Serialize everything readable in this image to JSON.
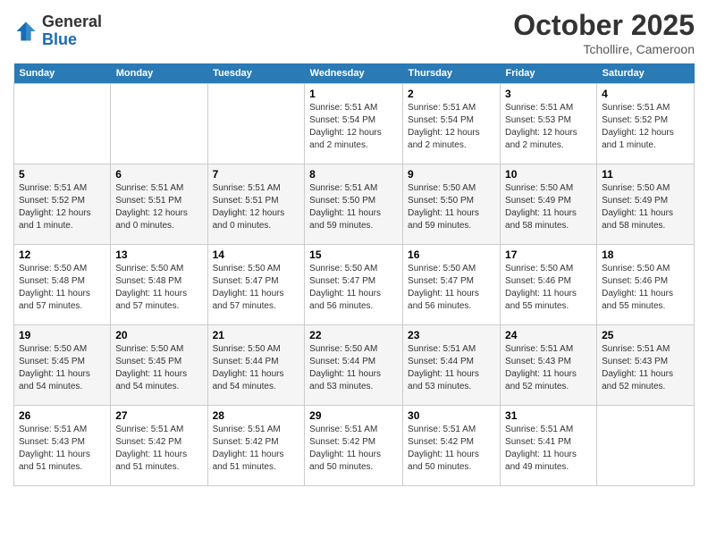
{
  "header": {
    "logo_general": "General",
    "logo_blue": "Blue",
    "month": "October 2025",
    "location": "Tchollire, Cameroon"
  },
  "days_of_week": [
    "Sunday",
    "Monday",
    "Tuesday",
    "Wednesday",
    "Thursday",
    "Friday",
    "Saturday"
  ],
  "weeks": [
    [
      {
        "day": "",
        "info": ""
      },
      {
        "day": "",
        "info": ""
      },
      {
        "day": "",
        "info": ""
      },
      {
        "day": "1",
        "info": "Sunrise: 5:51 AM\nSunset: 5:54 PM\nDaylight: 12 hours\nand 2 minutes."
      },
      {
        "day": "2",
        "info": "Sunrise: 5:51 AM\nSunset: 5:54 PM\nDaylight: 12 hours\nand 2 minutes."
      },
      {
        "day": "3",
        "info": "Sunrise: 5:51 AM\nSunset: 5:53 PM\nDaylight: 12 hours\nand 2 minutes."
      },
      {
        "day": "4",
        "info": "Sunrise: 5:51 AM\nSunset: 5:52 PM\nDaylight: 12 hours\nand 1 minute."
      }
    ],
    [
      {
        "day": "5",
        "info": "Sunrise: 5:51 AM\nSunset: 5:52 PM\nDaylight: 12 hours\nand 1 minute."
      },
      {
        "day": "6",
        "info": "Sunrise: 5:51 AM\nSunset: 5:51 PM\nDaylight: 12 hours\nand 0 minutes."
      },
      {
        "day": "7",
        "info": "Sunrise: 5:51 AM\nSunset: 5:51 PM\nDaylight: 12 hours\nand 0 minutes."
      },
      {
        "day": "8",
        "info": "Sunrise: 5:51 AM\nSunset: 5:50 PM\nDaylight: 11 hours\nand 59 minutes."
      },
      {
        "day": "9",
        "info": "Sunrise: 5:50 AM\nSunset: 5:50 PM\nDaylight: 11 hours\nand 59 minutes."
      },
      {
        "day": "10",
        "info": "Sunrise: 5:50 AM\nSunset: 5:49 PM\nDaylight: 11 hours\nand 58 minutes."
      },
      {
        "day": "11",
        "info": "Sunrise: 5:50 AM\nSunset: 5:49 PM\nDaylight: 11 hours\nand 58 minutes."
      }
    ],
    [
      {
        "day": "12",
        "info": "Sunrise: 5:50 AM\nSunset: 5:48 PM\nDaylight: 11 hours\nand 57 minutes."
      },
      {
        "day": "13",
        "info": "Sunrise: 5:50 AM\nSunset: 5:48 PM\nDaylight: 11 hours\nand 57 minutes."
      },
      {
        "day": "14",
        "info": "Sunrise: 5:50 AM\nSunset: 5:47 PM\nDaylight: 11 hours\nand 57 minutes."
      },
      {
        "day": "15",
        "info": "Sunrise: 5:50 AM\nSunset: 5:47 PM\nDaylight: 11 hours\nand 56 minutes."
      },
      {
        "day": "16",
        "info": "Sunrise: 5:50 AM\nSunset: 5:47 PM\nDaylight: 11 hours\nand 56 minutes."
      },
      {
        "day": "17",
        "info": "Sunrise: 5:50 AM\nSunset: 5:46 PM\nDaylight: 11 hours\nand 55 minutes."
      },
      {
        "day": "18",
        "info": "Sunrise: 5:50 AM\nSunset: 5:46 PM\nDaylight: 11 hours\nand 55 minutes."
      }
    ],
    [
      {
        "day": "19",
        "info": "Sunrise: 5:50 AM\nSunset: 5:45 PM\nDaylight: 11 hours\nand 54 minutes."
      },
      {
        "day": "20",
        "info": "Sunrise: 5:50 AM\nSunset: 5:45 PM\nDaylight: 11 hours\nand 54 minutes."
      },
      {
        "day": "21",
        "info": "Sunrise: 5:50 AM\nSunset: 5:44 PM\nDaylight: 11 hours\nand 54 minutes."
      },
      {
        "day": "22",
        "info": "Sunrise: 5:50 AM\nSunset: 5:44 PM\nDaylight: 11 hours\nand 53 minutes."
      },
      {
        "day": "23",
        "info": "Sunrise: 5:51 AM\nSunset: 5:44 PM\nDaylight: 11 hours\nand 53 minutes."
      },
      {
        "day": "24",
        "info": "Sunrise: 5:51 AM\nSunset: 5:43 PM\nDaylight: 11 hours\nand 52 minutes."
      },
      {
        "day": "25",
        "info": "Sunrise: 5:51 AM\nSunset: 5:43 PM\nDaylight: 11 hours\nand 52 minutes."
      }
    ],
    [
      {
        "day": "26",
        "info": "Sunrise: 5:51 AM\nSunset: 5:43 PM\nDaylight: 11 hours\nand 51 minutes."
      },
      {
        "day": "27",
        "info": "Sunrise: 5:51 AM\nSunset: 5:42 PM\nDaylight: 11 hours\nand 51 minutes."
      },
      {
        "day": "28",
        "info": "Sunrise: 5:51 AM\nSunset: 5:42 PM\nDaylight: 11 hours\nand 51 minutes."
      },
      {
        "day": "29",
        "info": "Sunrise: 5:51 AM\nSunset: 5:42 PM\nDaylight: 11 hours\nand 50 minutes."
      },
      {
        "day": "30",
        "info": "Sunrise: 5:51 AM\nSunset: 5:42 PM\nDaylight: 11 hours\nand 50 minutes."
      },
      {
        "day": "31",
        "info": "Sunrise: 5:51 AM\nSunset: 5:41 PM\nDaylight: 11 hours\nand 49 minutes."
      },
      {
        "day": "",
        "info": ""
      }
    ]
  ]
}
